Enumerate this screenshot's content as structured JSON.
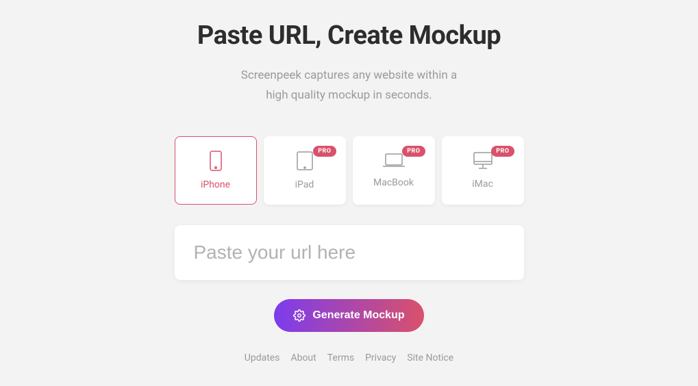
{
  "headline": "Paste URL, Create Mockup",
  "subtitle_line1": "Screenpeek captures any website within a",
  "subtitle_line2": "high quality mockup in seconds.",
  "devices": {
    "iphone": {
      "label": "iPhone"
    },
    "ipad": {
      "label": "iPad",
      "badge": "PRO"
    },
    "macbook": {
      "label": "MacBook",
      "badge": "PRO"
    },
    "imac": {
      "label": "iMac",
      "badge": "PRO"
    }
  },
  "input": {
    "placeholder": "Paste your url here"
  },
  "button": {
    "label": "Generate Mockup"
  },
  "footer": {
    "updates": "Updates",
    "about": "About",
    "terms": "Terms",
    "privacy": "Privacy",
    "site_notice": "Site Notice"
  }
}
